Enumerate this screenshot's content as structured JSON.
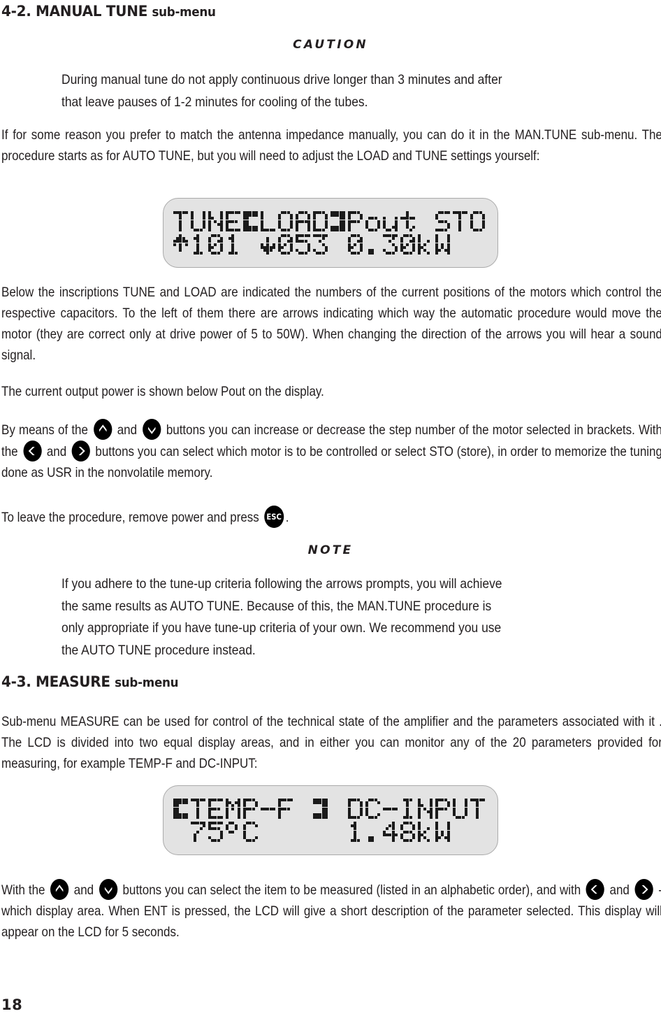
{
  "page": {
    "number": "18"
  },
  "sections": [
    {
      "id": "manual-tune",
      "heading_number": "4-2.",
      "heading_name": "MANUAL TUNE",
      "heading_suffix": "sub-menu"
    },
    {
      "id": "measure",
      "heading_number": "4-3.",
      "heading_name": "MEASURE",
      "heading_suffix": "sub-menu"
    }
  ],
  "caution": {
    "label": "CAUTION",
    "line1": "During manual tune do not apply continuous drive longer than 3 minutes and after",
    "line2": "that leave pauses of 1-2 minutes for cooling of the tubes."
  },
  "note": {
    "label": "NOTE",
    "line1": "If you adhere to the tune-up criteria following the arrows prompts, you will achieve",
    "line2": "the same results as AUTO TUNE. Because of this, the MAN.TUNE procedure is",
    "line3": "only appropriate if you have tune-up criteria of your own. We recommend you use",
    "line4": "the AUTO TUNE procedure instead."
  },
  "paragraphs": {
    "intro": "If for some reason you prefer to match the antenna impedance manually, you can do it in the MAN.TUNE sub-menu. The procedure starts as for AUTO TUNE, but you will need to adjust the LOAD and TUNE settings yourself:",
    "below_inscriptions": "Below the inscriptions TUNE and LOAD are indicated the numbers of the current positions of the motors which control the respective capacitors. To the left of them there are arrows indicating which way the automatic procedure would move the motor (they are correct only at drive power of 5 to 50W). When changing the direction of the arrows you will hear a sound signal.",
    "output_power": "The current output power is shown below Pout on the display.",
    "by_means_1": "By means of the",
    "by_means_2": "and",
    "by_means_3": "buttons you can increase or decrease the step number of the motor selected in brackets. With the",
    "by_means_4": "and",
    "by_means_5": "buttons you can select which motor is to be controlled or select STO (store), in order to memorize the tuning done as USR in the nonvolatile memory.",
    "leave_procedure_1": "To leave the procedure, remove power and press",
    "leave_procedure_2": ".",
    "measure_intro": "Sub-menu MEASURE can be used for control of the technical state of the amplifier and the parameters associated with it . The LCD is divided into two equal display areas, and in either you can monitor any of the 20 parameters provided for measuring, for example TEMP-F and DC-INPUT:",
    "with_the_1": "With the",
    "with_the_2": "and",
    "with_the_3": "buttons you can select the item to be measured (listed in an alphabetic order), and with",
    "with_the_4": "and",
    "with_the_5": "- which display area. When ENT is pressed, the LCD will give a short description of the parameter selected. This display will appear on the LCD for 5 seconds."
  },
  "buttons": {
    "up": "up-arrow",
    "down": "down-arrow",
    "left": "left-arrow",
    "right": "right-arrow",
    "esc": "ESC"
  },
  "lcd_displays": [
    {
      "id": "manual-tune-display",
      "line1": "TUNE[LOAD]Pout STO",
      "line2": "^101 v053 0.30kW",
      "fields": {
        "tune_label": "TUNE",
        "load_label": "LOAD",
        "pout_label": "Pout",
        "sto_label": "STO",
        "tune_value": "101",
        "tune_arrow": "up",
        "load_value": "053",
        "load_arrow": "down",
        "pout_value": "0.30kW"
      }
    },
    {
      "id": "measure-display",
      "line1": "[TEMP-F ] DC-INPUT",
      "line2": " 75°C     1.48kW",
      "fields": {
        "left_param": "TEMP-F",
        "left_value": "75°C",
        "right_param": "DC-INPUT",
        "right_value": "1.48kW"
      }
    }
  ],
  "colors": {
    "text": "#231f20",
    "lcd_background": "#e3e3e3",
    "lcd_border": "#aaaaaa",
    "lcd_pixel": "#1a1a1a",
    "button_fill": "#000000",
    "button_glyph": "#ffffff"
  }
}
